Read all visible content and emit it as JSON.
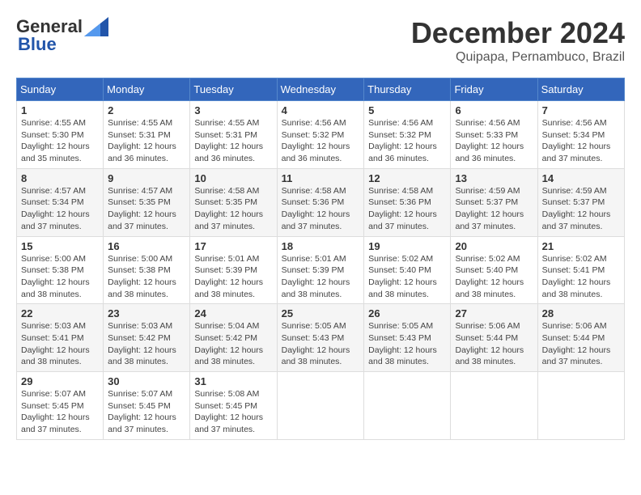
{
  "header": {
    "logo_general": "General",
    "logo_blue": "Blue",
    "month": "December 2024",
    "location": "Quipapa, Pernambuco, Brazil"
  },
  "weekdays": [
    "Sunday",
    "Monday",
    "Tuesday",
    "Wednesday",
    "Thursday",
    "Friday",
    "Saturday"
  ],
  "weeks": [
    [
      {
        "day": "1",
        "sunrise": "4:55 AM",
        "sunset": "5:30 PM",
        "daylight": "12 hours and 35 minutes."
      },
      {
        "day": "2",
        "sunrise": "4:55 AM",
        "sunset": "5:31 PM",
        "daylight": "12 hours and 36 minutes."
      },
      {
        "day": "3",
        "sunrise": "4:55 AM",
        "sunset": "5:31 PM",
        "daylight": "12 hours and 36 minutes."
      },
      {
        "day": "4",
        "sunrise": "4:56 AM",
        "sunset": "5:32 PM",
        "daylight": "12 hours and 36 minutes."
      },
      {
        "day": "5",
        "sunrise": "4:56 AM",
        "sunset": "5:32 PM",
        "daylight": "12 hours and 36 minutes."
      },
      {
        "day": "6",
        "sunrise": "4:56 AM",
        "sunset": "5:33 PM",
        "daylight": "12 hours and 36 minutes."
      },
      {
        "day": "7",
        "sunrise": "4:56 AM",
        "sunset": "5:34 PM",
        "daylight": "12 hours and 37 minutes."
      }
    ],
    [
      {
        "day": "8",
        "sunrise": "4:57 AM",
        "sunset": "5:34 PM",
        "daylight": "12 hours and 37 minutes."
      },
      {
        "day": "9",
        "sunrise": "4:57 AM",
        "sunset": "5:35 PM",
        "daylight": "12 hours and 37 minutes."
      },
      {
        "day": "10",
        "sunrise": "4:58 AM",
        "sunset": "5:35 PM",
        "daylight": "12 hours and 37 minutes."
      },
      {
        "day": "11",
        "sunrise": "4:58 AM",
        "sunset": "5:36 PM",
        "daylight": "12 hours and 37 minutes."
      },
      {
        "day": "12",
        "sunrise": "4:58 AM",
        "sunset": "5:36 PM",
        "daylight": "12 hours and 37 minutes."
      },
      {
        "day": "13",
        "sunrise": "4:59 AM",
        "sunset": "5:37 PM",
        "daylight": "12 hours and 37 minutes."
      },
      {
        "day": "14",
        "sunrise": "4:59 AM",
        "sunset": "5:37 PM",
        "daylight": "12 hours and 37 minutes."
      }
    ],
    [
      {
        "day": "15",
        "sunrise": "5:00 AM",
        "sunset": "5:38 PM",
        "daylight": "12 hours and 38 minutes."
      },
      {
        "day": "16",
        "sunrise": "5:00 AM",
        "sunset": "5:38 PM",
        "daylight": "12 hours and 38 minutes."
      },
      {
        "day": "17",
        "sunrise": "5:01 AM",
        "sunset": "5:39 PM",
        "daylight": "12 hours and 38 minutes."
      },
      {
        "day": "18",
        "sunrise": "5:01 AM",
        "sunset": "5:39 PM",
        "daylight": "12 hours and 38 minutes."
      },
      {
        "day": "19",
        "sunrise": "5:02 AM",
        "sunset": "5:40 PM",
        "daylight": "12 hours and 38 minutes."
      },
      {
        "day": "20",
        "sunrise": "5:02 AM",
        "sunset": "5:40 PM",
        "daylight": "12 hours and 38 minutes."
      },
      {
        "day": "21",
        "sunrise": "5:02 AM",
        "sunset": "5:41 PM",
        "daylight": "12 hours and 38 minutes."
      }
    ],
    [
      {
        "day": "22",
        "sunrise": "5:03 AM",
        "sunset": "5:41 PM",
        "daylight": "12 hours and 38 minutes."
      },
      {
        "day": "23",
        "sunrise": "5:03 AM",
        "sunset": "5:42 PM",
        "daylight": "12 hours and 38 minutes."
      },
      {
        "day": "24",
        "sunrise": "5:04 AM",
        "sunset": "5:42 PM",
        "daylight": "12 hours and 38 minutes."
      },
      {
        "day": "25",
        "sunrise": "5:05 AM",
        "sunset": "5:43 PM",
        "daylight": "12 hours and 38 minutes."
      },
      {
        "day": "26",
        "sunrise": "5:05 AM",
        "sunset": "5:43 PM",
        "daylight": "12 hours and 38 minutes."
      },
      {
        "day": "27",
        "sunrise": "5:06 AM",
        "sunset": "5:44 PM",
        "daylight": "12 hours and 38 minutes."
      },
      {
        "day": "28",
        "sunrise": "5:06 AM",
        "sunset": "5:44 PM",
        "daylight": "12 hours and 37 minutes."
      }
    ],
    [
      {
        "day": "29",
        "sunrise": "5:07 AM",
        "sunset": "5:45 PM",
        "daylight": "12 hours and 37 minutes."
      },
      {
        "day": "30",
        "sunrise": "5:07 AM",
        "sunset": "5:45 PM",
        "daylight": "12 hours and 37 minutes."
      },
      {
        "day": "31",
        "sunrise": "5:08 AM",
        "sunset": "5:45 PM",
        "daylight": "12 hours and 37 minutes."
      },
      null,
      null,
      null,
      null
    ]
  ]
}
